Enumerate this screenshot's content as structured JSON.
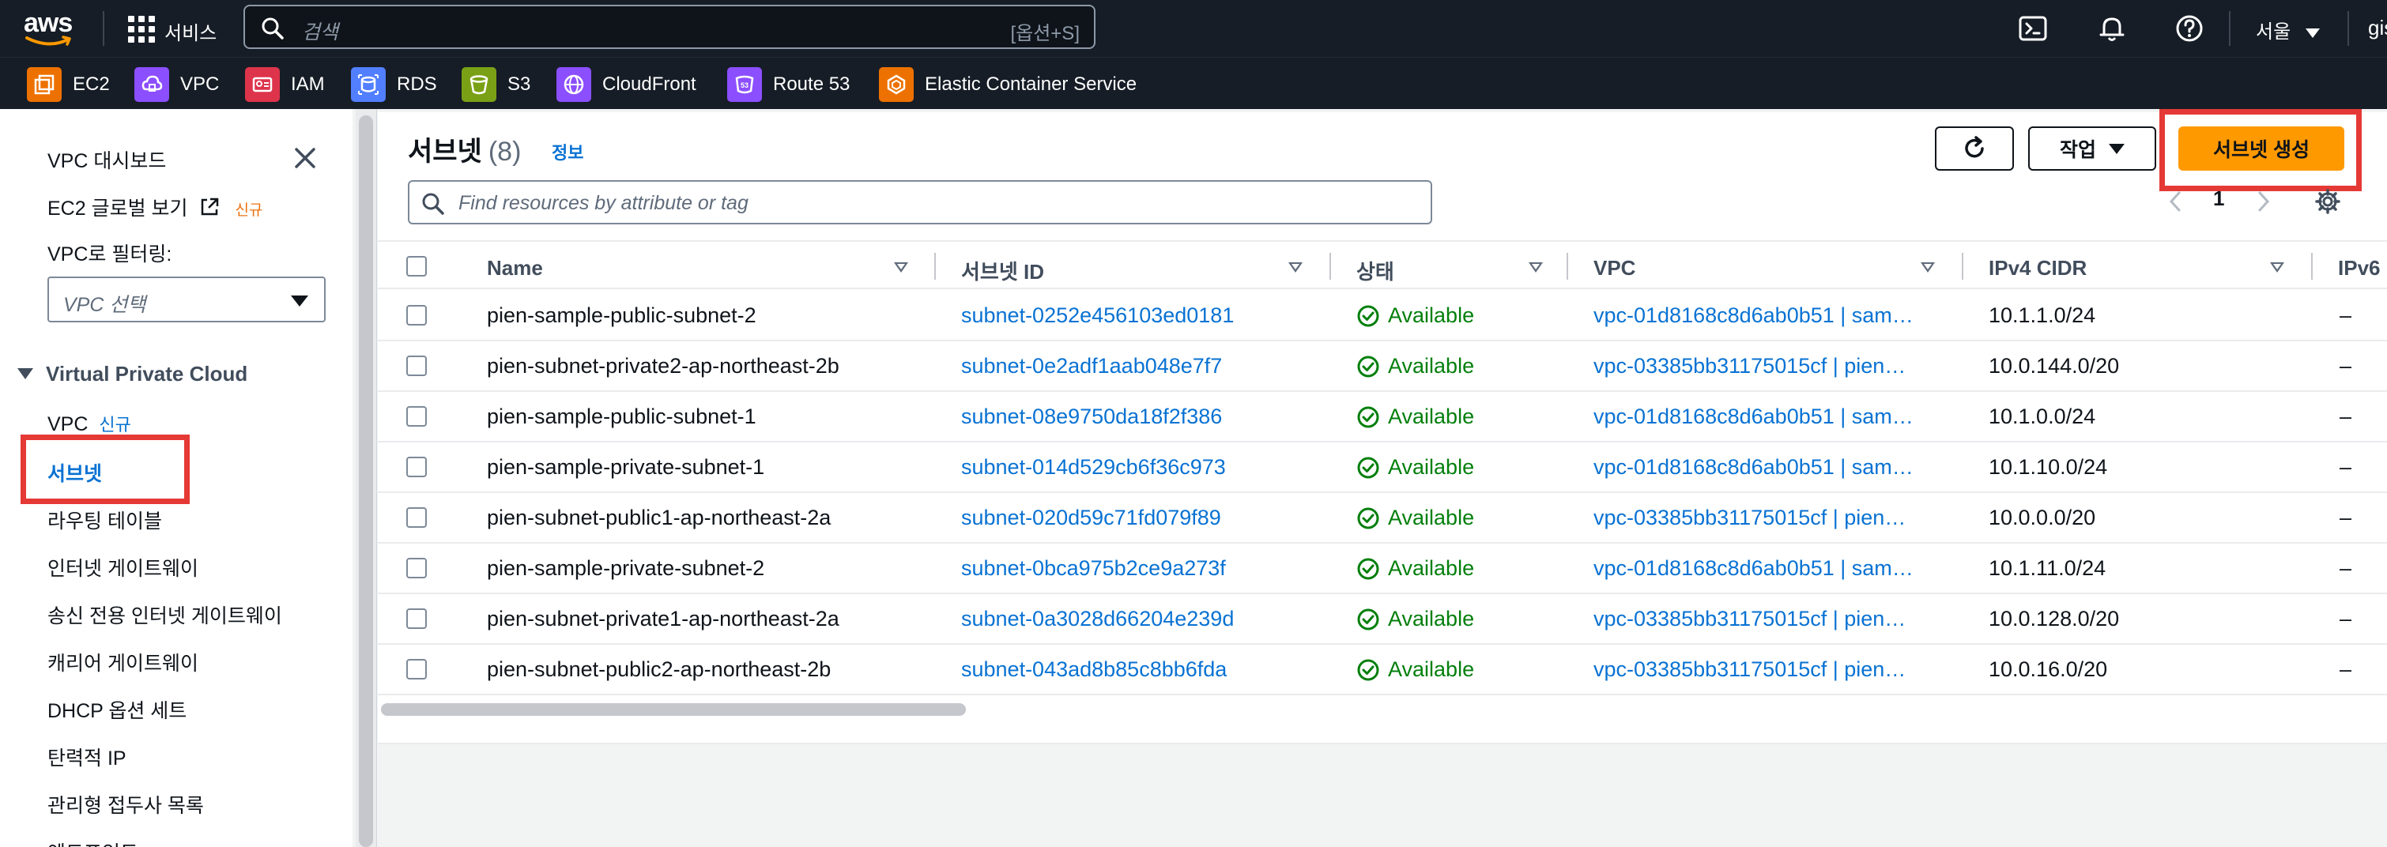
{
  "topbar": {
    "logo_text": "aws",
    "services_label": "서비스",
    "search_placeholder": "검색",
    "search_shortcut": "[옵션+S]",
    "region": "서울",
    "account": "gis"
  },
  "favorites": [
    {
      "label": "EC2",
      "icon": "ec2-icon",
      "color": "#ed7100"
    },
    {
      "label": "VPC",
      "icon": "vpc-icon",
      "color": "#8c4fff"
    },
    {
      "label": "IAM",
      "icon": "iam-icon",
      "color": "#dd344c"
    },
    {
      "label": "RDS",
      "icon": "rds-icon",
      "color": "#527fff"
    },
    {
      "label": "S3",
      "icon": "s3-icon",
      "color": "#7aa116"
    },
    {
      "label": "CloudFront",
      "icon": "cloudfront-icon",
      "color": "#8c4fff"
    },
    {
      "label": "Route 53",
      "icon": "route53-icon",
      "color": "#8c4fff"
    },
    {
      "label": "Elastic Container Service",
      "icon": "ecs-icon",
      "color": "#ed7100"
    }
  ],
  "sidebar": {
    "dashboard": "VPC 대시보드",
    "global_view": "EC2 글로벌 보기",
    "global_view_badge": "신규",
    "filter_label": "VPC로 필터링:",
    "filter_placeholder": "VPC 선택",
    "section": "Virtual Private Cloud",
    "items": [
      {
        "label": "VPC",
        "badge": "신규"
      },
      {
        "label": "서브넷"
      },
      {
        "label": "라우팅 테이블"
      },
      {
        "label": "인터넷 게이트웨이"
      },
      {
        "label": "송신 전용 인터넷 게이트웨이"
      },
      {
        "label": "캐리어 게이트웨이"
      },
      {
        "label": "DHCP 옵션 세트"
      },
      {
        "label": "탄력적 IP"
      },
      {
        "label": "관리형 접두사 목록"
      },
      {
        "label": "엔드포인트"
      }
    ]
  },
  "main": {
    "title": "서브넷",
    "count": "(8)",
    "info": "정보",
    "actions_label": "작업",
    "create_label": "서브넷 생성",
    "filter_placeholder": "Find resources by attribute or tag",
    "page": "1",
    "columns": [
      "Name",
      "서브넷 ID",
      "상태",
      "VPC",
      "IPv4 CIDR",
      "IPv6"
    ],
    "rows": [
      {
        "name": "pien-sample-public-subnet-2",
        "id": "subnet-0252e456103ed0181",
        "status": "Available",
        "vpc": "vpc-01d8168c8d6ab0b51 | sam…",
        "cidr": "10.1.1.0/24",
        "ipv6": "–"
      },
      {
        "name": "pien-subnet-private2-ap-northeast-2b",
        "id": "subnet-0e2adf1aab048e7f7",
        "status": "Available",
        "vpc": "vpc-03385bb31175015cf | pien…",
        "cidr": "10.0.144.0/20",
        "ipv6": "–"
      },
      {
        "name": "pien-sample-public-subnet-1",
        "id": "subnet-08e9750da18f2f386",
        "status": "Available",
        "vpc": "vpc-01d8168c8d6ab0b51 | sam…",
        "cidr": "10.1.0.0/24",
        "ipv6": "–"
      },
      {
        "name": "pien-sample-private-subnet-1",
        "id": "subnet-014d529cb6f36c973",
        "status": "Available",
        "vpc": "vpc-01d8168c8d6ab0b51 | sam…",
        "cidr": "10.1.10.0/24",
        "ipv6": "–"
      },
      {
        "name": "pien-subnet-public1-ap-northeast-2a",
        "id": "subnet-020d59c71fd079f89",
        "status": "Available",
        "vpc": "vpc-03385bb31175015cf | pien…",
        "cidr": "10.0.0.0/20",
        "ipv6": "–"
      },
      {
        "name": "pien-sample-private-subnet-2",
        "id": "subnet-0bca975b2ce9a273f",
        "status": "Available",
        "vpc": "vpc-01d8168c8d6ab0b51 | sam…",
        "cidr": "10.1.11.0/24",
        "ipv6": "–"
      },
      {
        "name": "pien-subnet-private1-ap-northeast-2a",
        "id": "subnet-0a3028d66204e239d",
        "status": "Available",
        "vpc": "vpc-03385bb31175015cf | pien…",
        "cidr": "10.0.128.0/20",
        "ipv6": "–"
      },
      {
        "name": "pien-subnet-public2-ap-northeast-2b",
        "id": "subnet-043ad8b85c8bb6fda",
        "status": "Available",
        "vpc": "vpc-03385bb31175015cf | pien…",
        "cidr": "10.0.16.0/20",
        "ipv6": "–"
      }
    ]
  },
  "colors": {
    "nav_bg": "#161d26",
    "link": "#0972d3",
    "primary_button": "#ff9900",
    "success": "#037f0c",
    "highlight_box": "#e53935"
  }
}
